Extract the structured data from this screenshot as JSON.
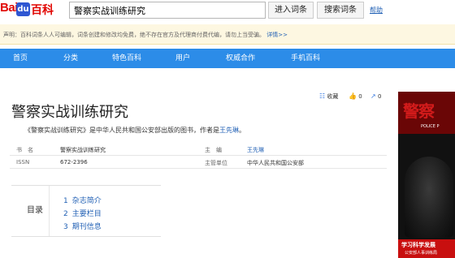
{
  "header": {
    "logo_bai": "Bai",
    "logo_paw": "du",
    "logo_baike": "百科",
    "search_value": "警察实战训练研究",
    "enter_button": "进入词条",
    "search_button": "搜索词条",
    "help_link": "帮助"
  },
  "notice": {
    "text": "声明：百科词条人人可编辑，词条创建和修改均免费，绝不存在官方及代理商付费代编，请勿上当受骗。",
    "more_link": "详情>>"
  },
  "nav": {
    "items": [
      "首页",
      "分类",
      "特色百科",
      "用户",
      "权威合作",
      "手机百科"
    ]
  },
  "entry": {
    "title": "警察实战训练研究",
    "actions": {
      "favorite": "收藏",
      "like_count": "0",
      "share_count": "0"
    },
    "description_prefix": "《警察实战训练研究》是中华人民共和国公安部出版的图书，作者是",
    "description_author": "王先琳",
    "description_suffix": "。"
  },
  "infobox": {
    "rows": [
      {
        "label1": "书　名",
        "value1": "警察实战训练研究",
        "label2": "主　编",
        "value2": "王先琳"
      },
      {
        "label1": "ISSN",
        "value1": "672-2396",
        "label2": "主管单位",
        "value2": "中华人民共和国公安部"
      }
    ]
  },
  "toc": {
    "heading": "目录",
    "items": [
      {
        "num": "1",
        "label": "杂志简介"
      },
      {
        "num": "2",
        "label": "主要栏目"
      },
      {
        "num": "3",
        "label": "期刊信息"
      }
    ]
  },
  "cover": {
    "masthead": "警察",
    "subtitle": "POLICE P",
    "strip_line1": "学习科学发展",
    "strip_line2": "公安部人事训练局"
  }
}
